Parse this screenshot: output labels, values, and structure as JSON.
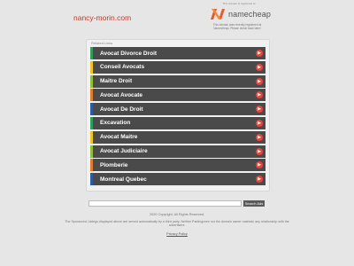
{
  "header": {
    "domain": "nancy-morin.com",
    "registrar_notice_top": "This domain is registered at",
    "registrar_name": "namecheap",
    "registrar_notice_bottom": "This domain was recently registered at Namecheap. Please check back later!"
  },
  "related": {
    "title": "Related Links",
    "items": [
      {
        "label": "Avocat Divorce Droit",
        "accent": "#2e9e5b"
      },
      {
        "label": "Conseil Avocats",
        "accent": "#f0c420"
      },
      {
        "label": "Maitre Droit",
        "accent": "#8fbf3a"
      },
      {
        "label": "Avocat Avocate",
        "accent": "#e07a2e"
      },
      {
        "label": "Avocat De Droit",
        "accent": "#2a5d9f"
      },
      {
        "label": "Excavation",
        "accent": "#2e9e5b"
      },
      {
        "label": "Avocat Maitre",
        "accent": "#f0c420"
      },
      {
        "label": "Avocat Judiciaire",
        "accent": "#8fbf3a"
      },
      {
        "label": "Plomberie",
        "accent": "#e07a2e"
      },
      {
        "label": "Montreal Quebec",
        "accent": "#2a5d9f"
      }
    ]
  },
  "search": {
    "placeholder": "",
    "button_label": "Search Ads"
  },
  "footer": {
    "copyright": "2020 Copyright. All Rights Reserved.",
    "disclaimer": "The Sponsored Listings displayed above are served automatically by a third party. Neither Parkingcrew nor the domain owner maintain any relationship with the advertisers.",
    "privacy_label": "Privacy Policy"
  },
  "colors": {
    "arrow": "#e8453c",
    "link_bg": "#4a4a4a",
    "domain": "#c0392b"
  }
}
